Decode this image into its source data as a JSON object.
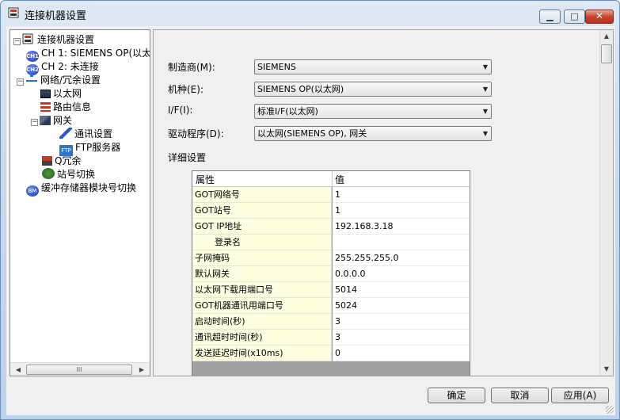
{
  "window": {
    "title": "连接机器设置",
    "buttons": {
      "minimize": "▁",
      "maximize": "□",
      "close": "✕"
    }
  },
  "tree": {
    "root": "连接机器设置",
    "ch1": "CH 1: SIEMENS OP(以太",
    "ch1_badge": "CH1",
    "ch2": "CH 2: 未连接",
    "ch2_badge": "CH2",
    "network": "网络/冗余设置",
    "ethernet": "以太网",
    "routing": "路由信息",
    "gateway": "网关",
    "comm_settings": "通讯设置",
    "ftp_server": "FTP服务器",
    "ftp_badge": "FTP",
    "q_redundant": "Q冗余",
    "station_switch": "站号切换",
    "buffer_switch": "缓冲存储器模块号切换",
    "buffer_badge": "BM",
    "expand_minus": "−",
    "hscroll_left": "◀",
    "hscroll_right": "▶",
    "hscroll_thumb": "III"
  },
  "form": {
    "maker": {
      "label": "制造商(M):",
      "value": "SIEMENS"
    },
    "model": {
      "label": "机种(E):",
      "value": "SIEMENS OP(以太网)"
    },
    "interface": {
      "label": "I/F(I):",
      "value": "标准I/F(以太网)"
    },
    "driver": {
      "label": "驱动程序(D):",
      "value": "以太网(SIEMENS OP), 网关"
    },
    "caret": "▼"
  },
  "detail": {
    "label": "详细设置",
    "headers": {
      "property": "属性",
      "value": "值"
    },
    "rows": [
      {
        "key": "GOT网络号",
        "value": "1"
      },
      {
        "key": "GOT站号",
        "value": "1"
      },
      {
        "key": "GOT IP地址",
        "value": "192.168.3.18"
      },
      {
        "key": "登录名",
        "value": ""
      },
      {
        "key": "子网掩码",
        "value": "255.255.255.0"
      },
      {
        "key": "默认网关",
        "value": "0.0.0.0"
      },
      {
        "key": "以太网下载用端口号",
        "value": "5014"
      },
      {
        "key": "GOT机器通讯用端口号",
        "value": "5024"
      },
      {
        "key": "启动时间(秒)",
        "value": "3"
      },
      {
        "key": "通讯超时时间(秒)",
        "value": "3"
      },
      {
        "key": "发送延迟时间(x10ms)",
        "value": "0"
      }
    ]
  },
  "vscroll": {
    "up": "▲",
    "down": "▼"
  },
  "footer": {
    "ok": "确定",
    "cancel": "取消",
    "apply": "应用(A)"
  }
}
